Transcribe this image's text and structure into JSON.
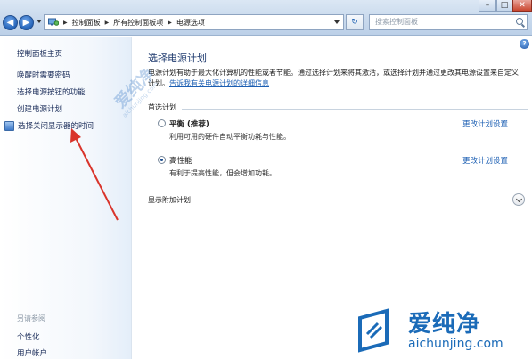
{
  "window": {
    "minimize_icon": "minimize-icon",
    "maximize_icon": "maximize-icon",
    "close_icon": "close-icon"
  },
  "nav": {
    "back_icon": "back-arrow-icon",
    "forward_icon": "forward-arrow-icon"
  },
  "address": {
    "crumbs": [
      "控制面板",
      "所有控制面板项",
      "电源选项"
    ]
  },
  "search": {
    "placeholder": "搜索控制面板"
  },
  "sidebar": {
    "home": "控制面板主页",
    "items": [
      "唤醒时需要密码",
      "选择电源按钮的功能",
      "创建电源计划",
      "选择关闭显示器的时间"
    ],
    "see_also": "另请参阅",
    "bottom_items": [
      "个性化",
      "用户帐户"
    ]
  },
  "main": {
    "title": "选择电源计划",
    "description": "电源计划有助于最大化计算机的性能或者节能。通过选择计划来将其激活，或选择计划并通过更改其电源设置来自定义计划。",
    "description_link": "告诉我有关电源计划的详细信息",
    "group_label": "首选计划",
    "plans": [
      {
        "name": "平衡 (推荐)",
        "desc": "利用可用的硬件自动平衡功耗与性能。",
        "selected": false,
        "change": "更改计划设置"
      },
      {
        "name": "高性能",
        "desc": "有利于提高性能，但会增加功耗。",
        "selected": true,
        "change": "更改计划设置"
      }
    ],
    "more_label": "显示附加计划"
  },
  "watermark": {
    "name": "爱纯净",
    "url": "aichunjing.com"
  },
  "colors": {
    "link": "#1c5fb3",
    "annotation_arrow": "#d9342b"
  }
}
